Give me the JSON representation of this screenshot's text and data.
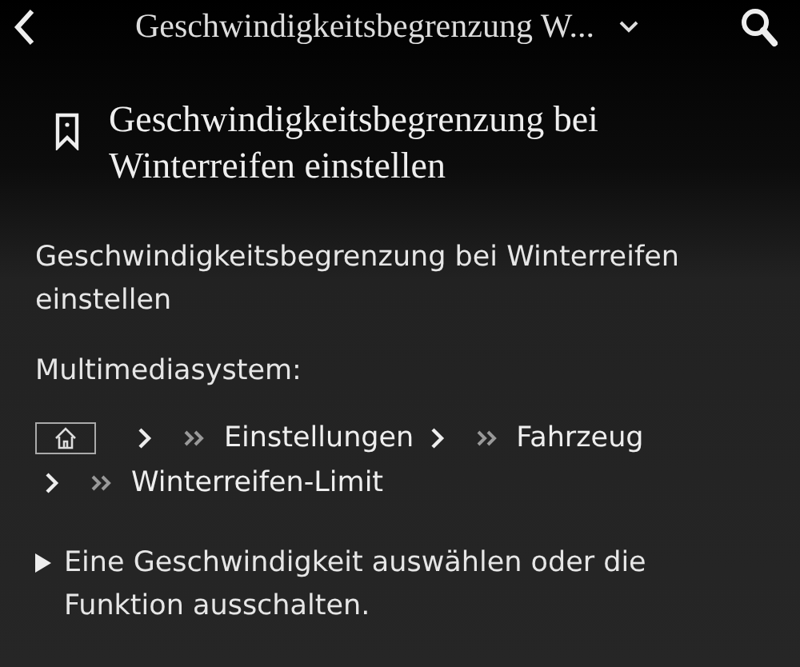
{
  "header": {
    "title": "Geschwindigkeitsbegrenzung W..."
  },
  "heading": "Geschwindigkeitsbegrenzung bei Winterreifen einstellen",
  "paragraphs": [
    "Geschwindigkeitsbegrenzung bei Winterreifen einstellen",
    "Multimediasystem:"
  ],
  "breadcrumb": [
    "Einstellungen",
    "Fahrzeug",
    "Winterreifen-Limit"
  ],
  "steps": [
    "Eine Geschwindigkeit auswählen oder die Funktion ausschalten."
  ]
}
